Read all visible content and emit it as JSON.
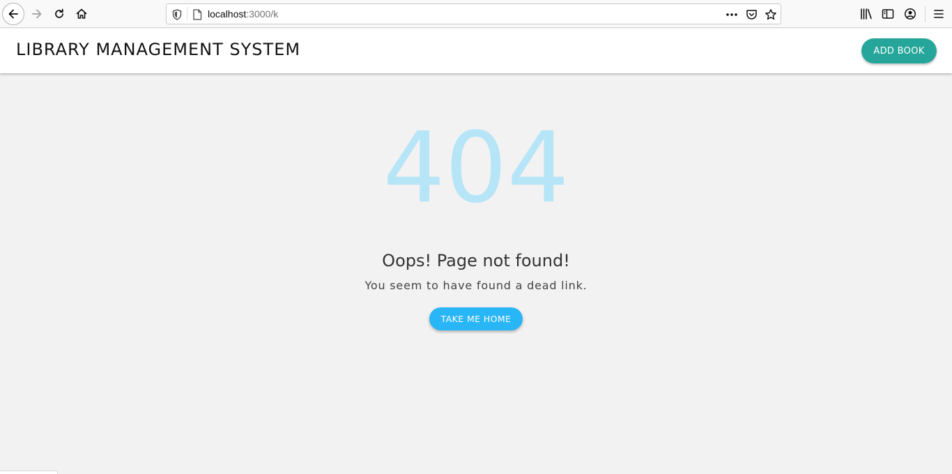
{
  "browser": {
    "url_host": "localhost",
    "url_path": ":3000/k"
  },
  "header": {
    "title": "LIBRARY MANAGEMENT SYSTEM",
    "add_book_label": "ADD BOOK",
    "accent_color": "#26a69a"
  },
  "error": {
    "code": "404",
    "title": "Oops! Page not found!",
    "subtitle": "You seem to have found a dead link.",
    "home_button_label": "TAKE ME HOME",
    "code_color": "#b6e5f7",
    "button_color": "#29b6f6"
  },
  "icons": {
    "back": "back-arrow-icon",
    "forward": "forward-arrow-icon",
    "reload": "reload-icon",
    "home": "home-icon",
    "tracking": "shield-icon",
    "page": "page-icon",
    "page_actions": "more-icon",
    "pocket": "pocket-icon",
    "bookmark": "star-icon",
    "library": "library-icon",
    "sidebar": "sidebar-icon",
    "account": "account-icon",
    "menu": "hamburger-menu-icon"
  }
}
